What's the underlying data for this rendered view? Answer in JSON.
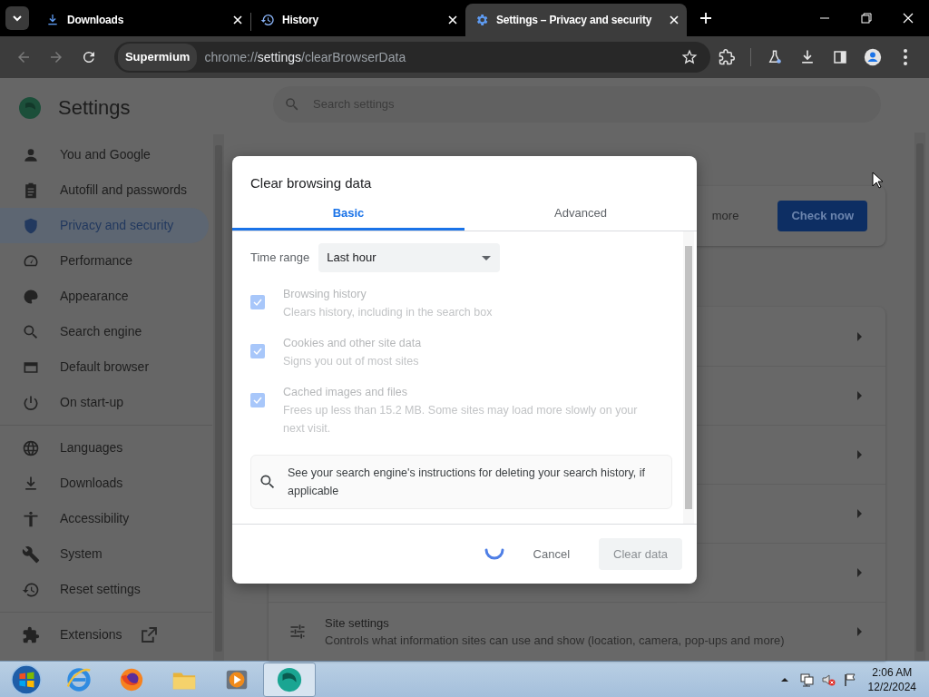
{
  "tab_strip": {
    "tabs": [
      {
        "label": "Downloads",
        "kind": "download",
        "selected": false
      },
      {
        "label": "History",
        "kind": "history",
        "selected": false
      },
      {
        "label": "Settings – Privacy and security",
        "kind": "gear",
        "selected": true
      }
    ]
  },
  "toolbar": {
    "nav": [
      {
        "kind": "back",
        "disabled": true
      },
      {
        "kind": "forward",
        "disabled": true
      },
      {
        "kind": "reload",
        "disabled": false
      }
    ],
    "site_chip": "Supermium",
    "url": {
      "scheme": "chrome://",
      "host": "settings",
      "path": "/clearBrowserData"
    }
  },
  "settings": {
    "title": "Settings",
    "search_placeholder": "Search settings",
    "sidebar_groups": [
      {
        "items": [
          {
            "label": "You and Google",
            "kind": "person",
            "selected": false
          },
          {
            "label": "Autofill and passwords",
            "kind": "clipboard",
            "selected": false
          },
          {
            "label": "Privacy and security",
            "kind": "shield",
            "selected": true
          },
          {
            "label": "Performance",
            "kind": "gauge",
            "selected": false
          },
          {
            "label": "Appearance",
            "kind": "palette",
            "selected": false
          },
          {
            "label": "Search engine",
            "kind": "search",
            "selected": false
          },
          {
            "label": "Default browser",
            "kind": "browser",
            "selected": false
          },
          {
            "label": "On start-up",
            "kind": "power",
            "selected": false
          }
        ]
      },
      {
        "items": [
          {
            "label": "Languages",
            "kind": "globe",
            "selected": false
          },
          {
            "label": "Downloads",
            "kind": "download",
            "selected": false
          },
          {
            "label": "Accessibility",
            "kind": "accessibility",
            "selected": false
          },
          {
            "label": "System",
            "kind": "wrench",
            "selected": false
          },
          {
            "label": "Reset settings",
            "kind": "history",
            "selected": false
          }
        ]
      },
      {
        "items": [
          {
            "label": "Extensions",
            "kind": "puzzle",
            "selected": false,
            "external": true
          }
        ]
      }
    ]
  },
  "safety_check": {
    "text": "more",
    "button": "Check now"
  },
  "privacy_card": {
    "rows": [
      {
        "title": "Site settings",
        "description": "Controls what information sites can use and show (location, camera, pop-ups and more)"
      }
    ]
  },
  "dialog": {
    "title": "Clear browsing data",
    "tabs": [
      {
        "label": "Basic",
        "selected": true
      },
      {
        "label": "Advanced",
        "selected": false
      }
    ],
    "time_range": {
      "label": "Time range",
      "value": "Last hour"
    },
    "options": [
      {
        "title": "Browsing history",
        "description": "Clears history, including in the search box",
        "checked": true,
        "disabled": true
      },
      {
        "title": "Cookies and other site data",
        "description": "Signs you out of most sites",
        "checked": true,
        "disabled": true
      },
      {
        "title": "Cached images and files",
        "description": "Frees up less than 15.2 MB. Some sites may load more slowly on your next visit.",
        "checked": true,
        "disabled": true
      }
    ],
    "info": "See your search engine's instructions for deleting your search history, if applicable",
    "loading": true,
    "buttons": [
      {
        "label": "Cancel",
        "kind": "text",
        "disabled": false
      },
      {
        "label": "Clear data",
        "kind": "filled",
        "disabled": true
      }
    ]
  },
  "taskbar": {
    "apps": [
      {
        "kind": "ie",
        "selected": false
      },
      {
        "kind": "firefox",
        "selected": false
      },
      {
        "kind": "explorer",
        "selected": false
      },
      {
        "kind": "media",
        "selected": false
      },
      {
        "kind": "supermium",
        "selected": true
      }
    ],
    "tray": {
      "time": "2:06 AM",
      "date": "12/2/2024"
    }
  }
}
